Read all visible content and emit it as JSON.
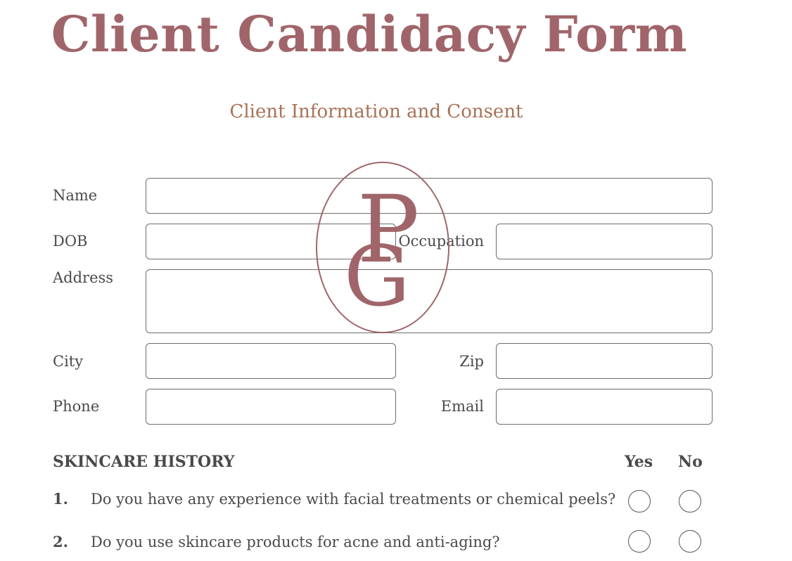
{
  "header": {
    "title": "Client Candidacy Form",
    "subtitle": "Client Information and Consent"
  },
  "logo": {
    "letters": "PG",
    "color": "#a0656a"
  },
  "form": {
    "name_label": "Name",
    "dob_label": "DOB",
    "occupation_label": "Occupation",
    "address_label": "Address",
    "city_label": "City",
    "zip_label": "Zip",
    "phone_label": "Phone",
    "email_label": "Email",
    "name_value": "",
    "dob_value": "",
    "occupation_value": "",
    "address_value": "",
    "city_value": "",
    "zip_value": "",
    "phone_value": "",
    "email_value": ""
  },
  "skincare": {
    "heading": "SKINCARE HISTORY",
    "yes_label": "Yes",
    "no_label": "No",
    "questions": [
      {
        "number": "1.",
        "text": "Do you have any experience with facial treatments or chemical peels?"
      },
      {
        "number": "2.",
        "text": "Do you use skincare products for acne and anti-aging?"
      }
    ]
  },
  "colors": {
    "title": "#a0656a",
    "subtitle": "#a77256",
    "text": "#4a4a4a"
  }
}
